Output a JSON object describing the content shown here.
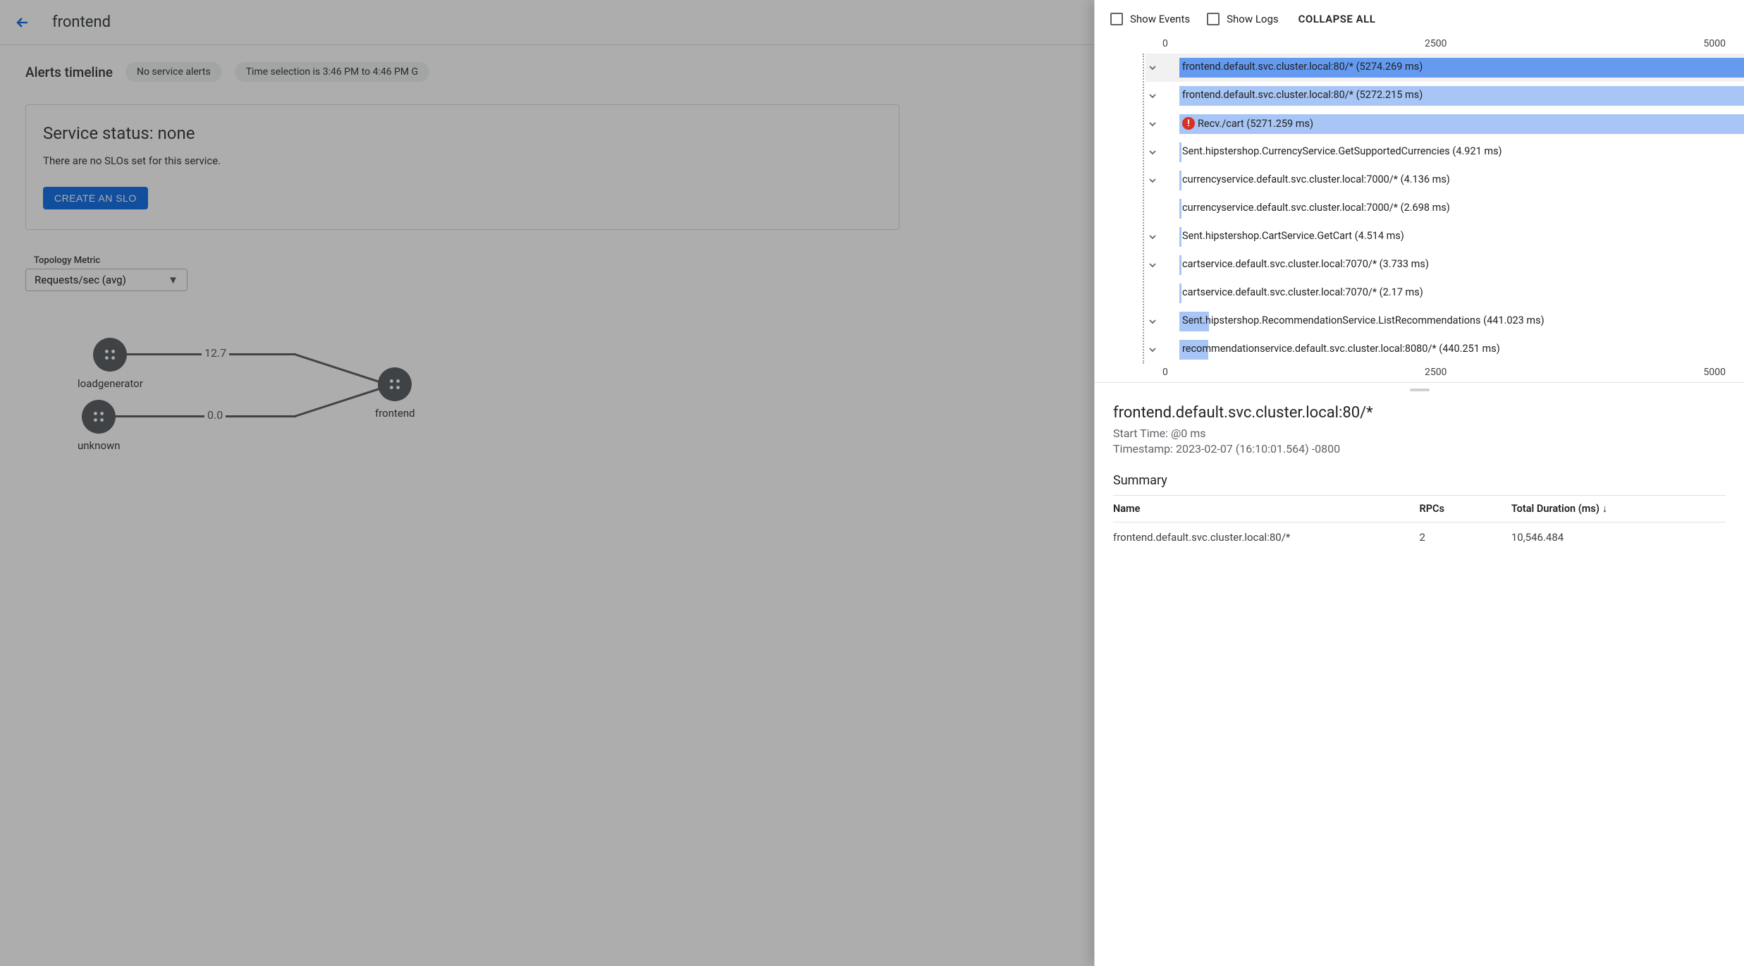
{
  "header": {
    "title": "frontend"
  },
  "alerts": {
    "label": "Alerts timeline",
    "no_alerts_pill": "No service alerts",
    "time_pill": "Time selection is 3:46 PM to 4:46 PM G"
  },
  "status_card": {
    "heading": "Service status: none",
    "subtext": "There are no SLOs set for this service.",
    "create_button": "CREATE AN SLO"
  },
  "topology": {
    "label": "Topology Metric",
    "selected": "Requests/sec (avg)",
    "nodes": {
      "loadgenerator": "loadgenerator",
      "unknown": "unknown",
      "frontend": "frontend"
    },
    "edges": {
      "top": "12.7",
      "bottom": "0.0"
    }
  },
  "trace_panel": {
    "show_events": "Show Events",
    "show_logs": "Show Logs",
    "collapse_all": "COLLAPSE ALL",
    "axis_ticks": [
      "0",
      "2500",
      "5000"
    ],
    "chart_data": {
      "type": "bar",
      "xlabel": "",
      "ylabel": "",
      "xlim": [
        0,
        5000
      ],
      "series": [
        {
          "name": "frontend.default.svc.cluster.local:80/*",
          "start": 0,
          "duration": 5274.269
        },
        {
          "name": "frontend.default.svc.cluster.local:80/*",
          "start": 0,
          "duration": 5272.215
        },
        {
          "name": "Recv./cart",
          "start": 0,
          "duration": 5271.259
        },
        {
          "name": "Sent.hipstershop.CurrencyService.GetSupportedCurrencies",
          "start": 0,
          "duration": 4.921
        },
        {
          "name": "currencyservice.default.svc.cluster.local:7000/*",
          "start": 0,
          "duration": 4.136
        },
        {
          "name": "currencyservice.default.svc.cluster.local:7000/*",
          "start": 0,
          "duration": 2.698
        },
        {
          "name": "Sent.hipstershop.CartService.GetCart",
          "start": 0,
          "duration": 4.514
        },
        {
          "name": "cartservice.default.svc.cluster.local:7070/*",
          "start": 0,
          "duration": 3.733
        },
        {
          "name": "cartservice.default.svc.cluster.local:7070/*",
          "start": 0,
          "duration": 2.17
        },
        {
          "name": "Sent.hipstershop.RecommendationService.ListRecommendations",
          "start": 0,
          "duration": 441.023
        },
        {
          "name": "recommendationservice.default.svc.cluster.local:8080/*",
          "start": 0,
          "duration": 440.251
        }
      ]
    },
    "spans": [
      {
        "label": "frontend.default.svc.cluster.local:80/* (5274.269 ms)",
        "color": "#649bf0",
        "width_pct": 100,
        "expand": true,
        "highlight": true
      },
      {
        "label": "frontend.default.svc.cluster.local:80/* (5272.215 ms)",
        "color": "#a7c5f5",
        "width_pct": 100,
        "expand": true
      },
      {
        "label": "Recv./cart (5271.259 ms)",
        "color": "#a7c5f5",
        "width_pct": 100,
        "expand": true,
        "error": true
      },
      {
        "label": "Sent.hipstershop.CurrencyService.GetSupportedCurrencies (4.921 ms)",
        "color": "#a7c5f5",
        "width_pct": 0.5,
        "expand": true
      },
      {
        "label": "currencyservice.default.svc.cluster.local:7000/* (4.136 ms)",
        "color": "#a7c5f5",
        "width_pct": 0.5,
        "expand": true
      },
      {
        "label": "currencyservice.default.svc.cluster.local:7000/* (2.698 ms)",
        "color": "#a7c5f5",
        "width_pct": 0.4,
        "expand": false
      },
      {
        "label": "Sent.hipstershop.CartService.GetCart (4.514 ms)",
        "color": "#a7c5f5",
        "width_pct": 0.5,
        "expand": true
      },
      {
        "label": "cartservice.default.svc.cluster.local:7070/* (3.733 ms)",
        "color": "#a7c5f5",
        "width_pct": 0.5,
        "expand": true
      },
      {
        "label": "cartservice.default.svc.cluster.local:7070/* (2.17 ms)",
        "color": "#a7c5f5",
        "width_pct": 0.4,
        "expand": false
      },
      {
        "label": "Sent.hipstershop.RecommendationService.ListRecommendations (441.023 ms)",
        "color": "#a7c5f5",
        "width_pct": 8.4,
        "expand": true
      },
      {
        "label": "recommendationservice.default.svc.cluster.local:8080/* (440.251 ms)",
        "color": "#a7c5f5",
        "width_pct": 8.3,
        "expand": true
      }
    ]
  },
  "detail": {
    "title": "frontend.default.svc.cluster.local:80/*",
    "start_time_label": "Start Time: ",
    "start_time_value": "@0 ms",
    "timestamp_label": "Timestamp: ",
    "timestamp_value": "2023-02-07 (16:10:01.564) -0800",
    "summary_heading": "Summary",
    "table": {
      "headers": [
        "Name",
        "RPCs",
        "Total Duration (ms)"
      ],
      "rows": [
        {
          "name": "frontend.default.svc.cluster.local:80/*",
          "rpcs": "2",
          "duration": "10,546.484"
        }
      ]
    }
  }
}
